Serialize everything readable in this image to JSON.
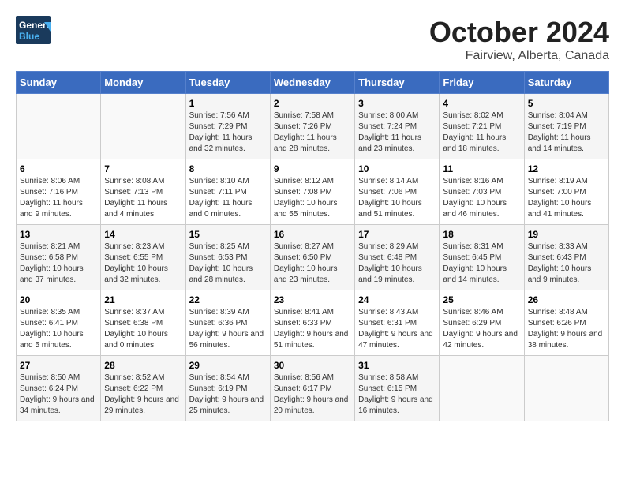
{
  "logo": {
    "line1": "General",
    "line2": "Blue"
  },
  "title": "October 2024",
  "subtitle": "Fairview, Alberta, Canada",
  "days_of_week": [
    "Sunday",
    "Monday",
    "Tuesday",
    "Wednesday",
    "Thursday",
    "Friday",
    "Saturday"
  ],
  "weeks": [
    [
      {
        "day": "",
        "sunrise": "",
        "sunset": "",
        "daylight": ""
      },
      {
        "day": "",
        "sunrise": "",
        "sunset": "",
        "daylight": ""
      },
      {
        "day": "1",
        "sunrise": "Sunrise: 7:56 AM",
        "sunset": "Sunset: 7:29 PM",
        "daylight": "Daylight: 11 hours and 32 minutes."
      },
      {
        "day": "2",
        "sunrise": "Sunrise: 7:58 AM",
        "sunset": "Sunset: 7:26 PM",
        "daylight": "Daylight: 11 hours and 28 minutes."
      },
      {
        "day": "3",
        "sunrise": "Sunrise: 8:00 AM",
        "sunset": "Sunset: 7:24 PM",
        "daylight": "Daylight: 11 hours and 23 minutes."
      },
      {
        "day": "4",
        "sunrise": "Sunrise: 8:02 AM",
        "sunset": "Sunset: 7:21 PM",
        "daylight": "Daylight: 11 hours and 18 minutes."
      },
      {
        "day": "5",
        "sunrise": "Sunrise: 8:04 AM",
        "sunset": "Sunset: 7:19 PM",
        "daylight": "Daylight: 11 hours and 14 minutes."
      }
    ],
    [
      {
        "day": "6",
        "sunrise": "Sunrise: 8:06 AM",
        "sunset": "Sunset: 7:16 PM",
        "daylight": "Daylight: 11 hours and 9 minutes."
      },
      {
        "day": "7",
        "sunrise": "Sunrise: 8:08 AM",
        "sunset": "Sunset: 7:13 PM",
        "daylight": "Daylight: 11 hours and 4 minutes."
      },
      {
        "day": "8",
        "sunrise": "Sunrise: 8:10 AM",
        "sunset": "Sunset: 7:11 PM",
        "daylight": "Daylight: 11 hours and 0 minutes."
      },
      {
        "day": "9",
        "sunrise": "Sunrise: 8:12 AM",
        "sunset": "Sunset: 7:08 PM",
        "daylight": "Daylight: 10 hours and 55 minutes."
      },
      {
        "day": "10",
        "sunrise": "Sunrise: 8:14 AM",
        "sunset": "Sunset: 7:06 PM",
        "daylight": "Daylight: 10 hours and 51 minutes."
      },
      {
        "day": "11",
        "sunrise": "Sunrise: 8:16 AM",
        "sunset": "Sunset: 7:03 PM",
        "daylight": "Daylight: 10 hours and 46 minutes."
      },
      {
        "day": "12",
        "sunrise": "Sunrise: 8:19 AM",
        "sunset": "Sunset: 7:00 PM",
        "daylight": "Daylight: 10 hours and 41 minutes."
      }
    ],
    [
      {
        "day": "13",
        "sunrise": "Sunrise: 8:21 AM",
        "sunset": "Sunset: 6:58 PM",
        "daylight": "Daylight: 10 hours and 37 minutes."
      },
      {
        "day": "14",
        "sunrise": "Sunrise: 8:23 AM",
        "sunset": "Sunset: 6:55 PM",
        "daylight": "Daylight: 10 hours and 32 minutes."
      },
      {
        "day": "15",
        "sunrise": "Sunrise: 8:25 AM",
        "sunset": "Sunset: 6:53 PM",
        "daylight": "Daylight: 10 hours and 28 minutes."
      },
      {
        "day": "16",
        "sunrise": "Sunrise: 8:27 AM",
        "sunset": "Sunset: 6:50 PM",
        "daylight": "Daylight: 10 hours and 23 minutes."
      },
      {
        "day": "17",
        "sunrise": "Sunrise: 8:29 AM",
        "sunset": "Sunset: 6:48 PM",
        "daylight": "Daylight: 10 hours and 19 minutes."
      },
      {
        "day": "18",
        "sunrise": "Sunrise: 8:31 AM",
        "sunset": "Sunset: 6:45 PM",
        "daylight": "Daylight: 10 hours and 14 minutes."
      },
      {
        "day": "19",
        "sunrise": "Sunrise: 8:33 AM",
        "sunset": "Sunset: 6:43 PM",
        "daylight": "Daylight: 10 hours and 9 minutes."
      }
    ],
    [
      {
        "day": "20",
        "sunrise": "Sunrise: 8:35 AM",
        "sunset": "Sunset: 6:41 PM",
        "daylight": "Daylight: 10 hours and 5 minutes."
      },
      {
        "day": "21",
        "sunrise": "Sunrise: 8:37 AM",
        "sunset": "Sunset: 6:38 PM",
        "daylight": "Daylight: 10 hours and 0 minutes."
      },
      {
        "day": "22",
        "sunrise": "Sunrise: 8:39 AM",
        "sunset": "Sunset: 6:36 PM",
        "daylight": "Daylight: 9 hours and 56 minutes."
      },
      {
        "day": "23",
        "sunrise": "Sunrise: 8:41 AM",
        "sunset": "Sunset: 6:33 PM",
        "daylight": "Daylight: 9 hours and 51 minutes."
      },
      {
        "day": "24",
        "sunrise": "Sunrise: 8:43 AM",
        "sunset": "Sunset: 6:31 PM",
        "daylight": "Daylight: 9 hours and 47 minutes."
      },
      {
        "day": "25",
        "sunrise": "Sunrise: 8:46 AM",
        "sunset": "Sunset: 6:29 PM",
        "daylight": "Daylight: 9 hours and 42 minutes."
      },
      {
        "day": "26",
        "sunrise": "Sunrise: 8:48 AM",
        "sunset": "Sunset: 6:26 PM",
        "daylight": "Daylight: 9 hours and 38 minutes."
      }
    ],
    [
      {
        "day": "27",
        "sunrise": "Sunrise: 8:50 AM",
        "sunset": "Sunset: 6:24 PM",
        "daylight": "Daylight: 9 hours and 34 minutes."
      },
      {
        "day": "28",
        "sunrise": "Sunrise: 8:52 AM",
        "sunset": "Sunset: 6:22 PM",
        "daylight": "Daylight: 9 hours and 29 minutes."
      },
      {
        "day": "29",
        "sunrise": "Sunrise: 8:54 AM",
        "sunset": "Sunset: 6:19 PM",
        "daylight": "Daylight: 9 hours and 25 minutes."
      },
      {
        "day": "30",
        "sunrise": "Sunrise: 8:56 AM",
        "sunset": "Sunset: 6:17 PM",
        "daylight": "Daylight: 9 hours and 20 minutes."
      },
      {
        "day": "31",
        "sunrise": "Sunrise: 8:58 AM",
        "sunset": "Sunset: 6:15 PM",
        "daylight": "Daylight: 9 hours and 16 minutes."
      },
      {
        "day": "",
        "sunrise": "",
        "sunset": "",
        "daylight": ""
      },
      {
        "day": "",
        "sunrise": "",
        "sunset": "",
        "daylight": ""
      }
    ]
  ]
}
